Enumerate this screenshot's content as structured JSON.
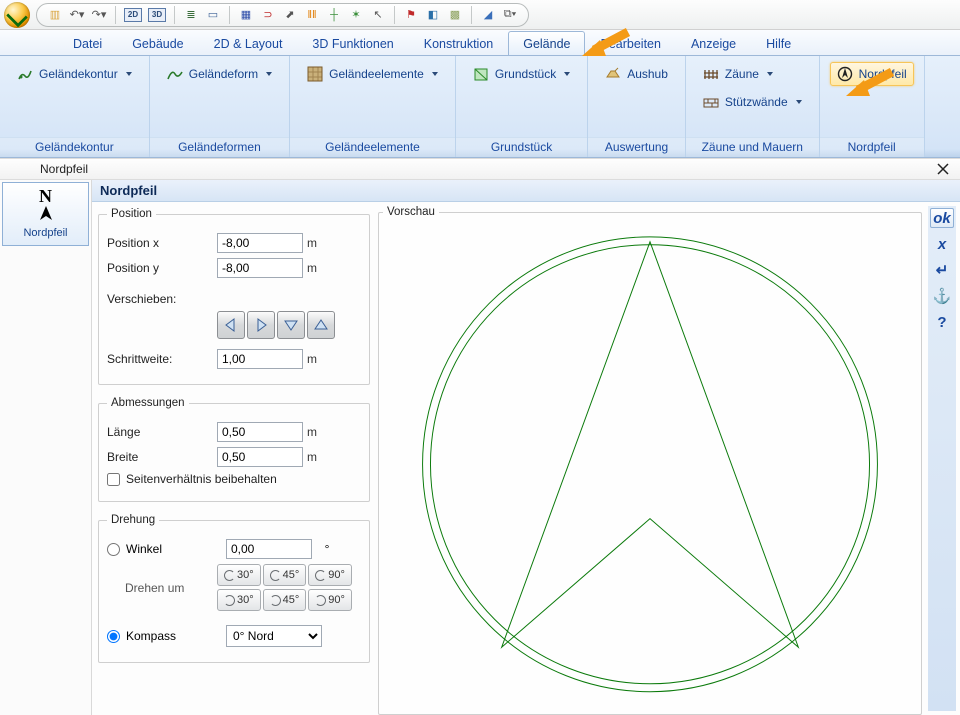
{
  "menu": {
    "tabs": [
      "Datei",
      "Gebäude",
      "2D & Layout",
      "3D Funktionen",
      "Konstruktion",
      "Gelände",
      "Bearbeiten",
      "Anzeige",
      "Hilfe"
    ],
    "active": "Gelände"
  },
  "ribbon": {
    "groups": [
      {
        "label": "Geländekontur",
        "items": [
          {
            "text": "Geländekontur",
            "icon": "contour",
            "dd": true
          }
        ]
      },
      {
        "label": "Geländeformen",
        "items": [
          {
            "text": "Geländeform",
            "icon": "hill",
            "dd": true
          }
        ]
      },
      {
        "label": "Geländeelemente",
        "items": [
          {
            "text": "Geländeelemente",
            "icon": "terrain-tile",
            "dd": true
          }
        ]
      },
      {
        "label": "Grundstück",
        "items": [
          {
            "text": "Grundstück",
            "icon": "lot",
            "dd": true
          }
        ]
      },
      {
        "label": "Auswertung",
        "items": [
          {
            "text": "Aushub",
            "icon": "excavation",
            "dd": false
          }
        ]
      },
      {
        "label": "Zäune und Mauern",
        "items": [
          {
            "text": "Zäune",
            "icon": "fence",
            "dd": true
          },
          {
            "text": "Stützwände",
            "icon": "wall",
            "dd": true
          }
        ]
      },
      {
        "label": "Nordpfeil",
        "items": [
          {
            "text": "Nordpfeil",
            "icon": "north",
            "dd": false,
            "highlight": true
          }
        ]
      }
    ]
  },
  "dialog": {
    "title": "Nordpfeil",
    "header": "Nordpfeil",
    "sideTab": {
      "glyph": "N",
      "label": "Nordpfeil"
    },
    "position": {
      "legend": "Position",
      "posx_label": "Position x",
      "posx": "-8,00",
      "posx_unit": "m",
      "posy_label": "Position y",
      "posy": "-8,00",
      "posy_unit": "m",
      "move_label": "Verschieben:",
      "step_label": "Schrittweite:",
      "step": "1,00",
      "step_unit": "m"
    },
    "dims": {
      "legend": "Abmessungen",
      "len_label": "Länge",
      "len": "0,50",
      "len_unit": "m",
      "wid_label": "Breite",
      "wid": "0,50",
      "wid_unit": "m",
      "aspect_label": "Seitenverhältnis beibehalten"
    },
    "rot": {
      "legend": "Drehung",
      "angle_label": "Winkel",
      "angle": "0,00",
      "angle_unit": "°",
      "rotate_by_label": "Drehen um",
      "compass_label": "Kompass",
      "compass_value": "0° Nord",
      "rot30": "30°",
      "rot45": "45°",
      "rot90": "90°"
    },
    "preview_legend": "Vorschau",
    "ok": "ok"
  }
}
